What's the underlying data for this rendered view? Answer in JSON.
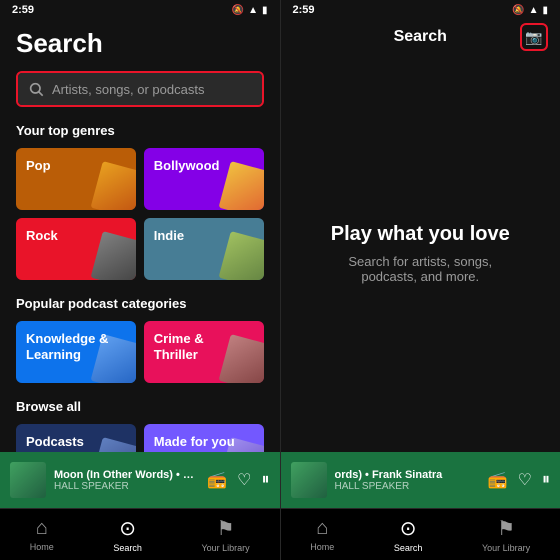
{
  "left": {
    "status": {
      "time": "2:59",
      "icons": [
        "signal",
        "wifi",
        "battery"
      ]
    },
    "title": "Search",
    "search_placeholder": "Artists, songs, or podcasts",
    "sections": {
      "top_genres_label": "Your top genres",
      "podcast_categories_label": "Popular podcast categories",
      "browse_all_label": "Browse all"
    },
    "genres": [
      {
        "id": "pop",
        "label": "Pop",
        "color_class": "genre-pop",
        "art_class": "art-pop"
      },
      {
        "id": "bollywood",
        "label": "Bollywood",
        "color_class": "genre-bollywood",
        "art_class": "art-bollywood"
      },
      {
        "id": "rock",
        "label": "Rock",
        "color_class": "genre-rock",
        "art_class": "art-rock"
      },
      {
        "id": "indie",
        "label": "Indie",
        "color_class": "genre-indie",
        "art_class": "art-indie"
      }
    ],
    "podcast_categories": [
      {
        "id": "knowledge",
        "label": "Knowledge &\nLearning",
        "color_class": "genre-knowledge",
        "art_class": "art-knowledge"
      },
      {
        "id": "crime",
        "label": "Crime &\nThriller",
        "color_class": "genre-crime",
        "art_class": "art-crime"
      }
    ],
    "browse_all": [
      {
        "id": "podcasts",
        "label": "Podcasts",
        "color_class": "genre-podcasts",
        "art_class": "art-podcasts"
      },
      {
        "id": "madeforyou",
        "label": "Made for you",
        "color_class": "genre-madeforyou",
        "art_class": "art-madeforyou"
      }
    ],
    "now_playing": {
      "title": "Moon (In Other Words) • Frank",
      "subtitle": "HALL SPEAKER",
      "icon": "📻"
    },
    "nav": [
      {
        "id": "home",
        "label": "Home",
        "icon": "⌂",
        "active": false
      },
      {
        "id": "search",
        "label": "Search",
        "icon": "⊙",
        "active": true
      },
      {
        "id": "library",
        "label": "Your Library",
        "icon": "⚑",
        "active": false
      }
    ]
  },
  "right": {
    "status": {
      "time": "2:59"
    },
    "header": {
      "title": "Search",
      "camera_label": "📷"
    },
    "main": {
      "title": "Play what you love",
      "subtitle": "Search for artists, songs, podcasts, and more."
    },
    "now_playing": {
      "title": "ords) • Frank Sinatra",
      "subtitle": "HALL SPEAKER"
    },
    "nav": [
      {
        "id": "home",
        "label": "Home",
        "icon": "⌂",
        "active": false
      },
      {
        "id": "search",
        "label": "Search",
        "icon": "⊙",
        "active": true
      }
    ]
  }
}
